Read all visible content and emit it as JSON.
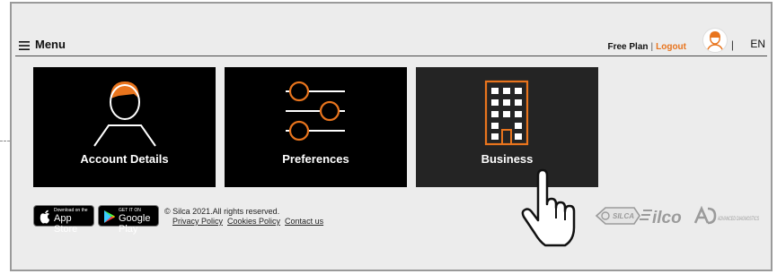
{
  "header": {
    "menu_label": "Menu",
    "plan": "Free Plan",
    "separator": "|",
    "logout": "Logout",
    "divider": "|",
    "language": "EN"
  },
  "tiles": [
    {
      "label": "Account Details",
      "icon": "user-icon"
    },
    {
      "label": "Preferences",
      "icon": "sliders-icon"
    },
    {
      "label": "Business",
      "icon": "building-icon"
    }
  ],
  "footer": {
    "app_store_small": "Download on the",
    "app_store_big": "App Store",
    "google_play_small": "GET IT ON",
    "google_play_big": "Google Play",
    "copyright": "© Silca 2021.All rights reserved.",
    "links": [
      "Privacy Policy",
      "Cookies Policy",
      "Contact us"
    ]
  },
  "brands": [
    "SILCA",
    "ilco",
    "ADVANCED DIAGNOSTICS"
  ],
  "colors": {
    "accent": "#e8741d",
    "tile": "#000000",
    "tile_active": "#242424"
  }
}
